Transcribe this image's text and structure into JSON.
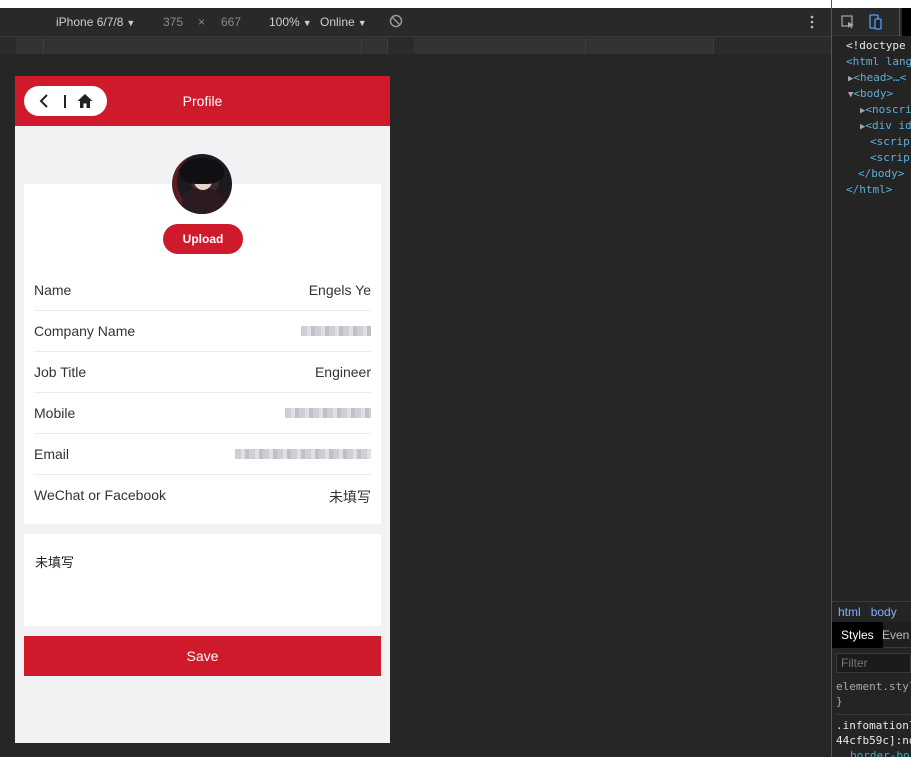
{
  "toolbar": {
    "device": "iPhone 6/7/8",
    "width": "375",
    "times": "×",
    "height": "667",
    "zoom": "100%",
    "network": "Online"
  },
  "app": {
    "title": "Profile",
    "upload_label": "Upload",
    "fields": [
      {
        "label": "Name",
        "value": "Engels Ye",
        "blurred": false
      },
      {
        "label": "Company Name",
        "value": "",
        "blurred": true
      },
      {
        "label": "Job Title",
        "value": "Engineer",
        "blurred": false
      },
      {
        "label": "Mobile",
        "value": "",
        "blurred": true
      },
      {
        "label": "Email",
        "value": "",
        "blurred": true
      },
      {
        "label": "WeChat or Facebook",
        "value": "未填写",
        "blurred": false
      }
    ],
    "note_text": "未填写",
    "save_label": "Save",
    "accent_color": "#cf1a2b"
  },
  "devtools": {
    "code_lines": [
      "<!doctype",
      "<html lang",
      "<head>…<",
      "<body>",
      "<noscri",
      "<div id",
      "<script",
      "<script",
      "</body>",
      "</html>"
    ],
    "crumbs": [
      "html",
      "body"
    ],
    "tab_styles": "Styles",
    "tab_events": "Even",
    "filter_placeholder": "Filter",
    "rule_lines": [
      "element.styl",
      "}",
      ".infomationl",
      "44cfb59c]:no",
      "border-bo"
    ]
  }
}
